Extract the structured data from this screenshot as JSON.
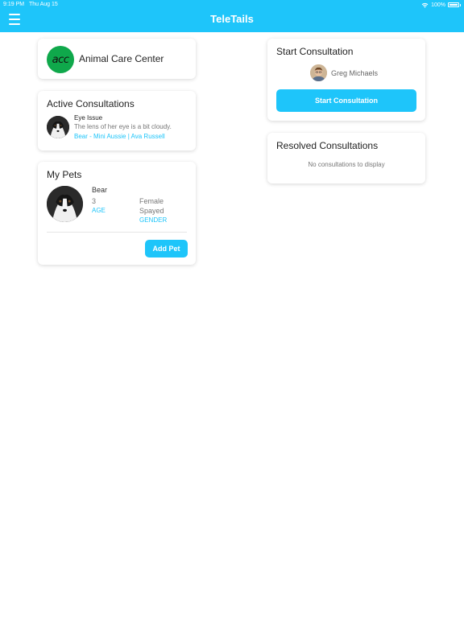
{
  "status_bar": {
    "time": "9:19 PM",
    "date": "Thu Aug 15",
    "battery": "100%",
    "wifi_icon": "wifi-icon",
    "battery_icon": "battery-icon"
  },
  "header": {
    "title": "TeleTails",
    "menu_icon": "hamburger-menu-icon"
  },
  "colors": {
    "accent": "#1ec5fa",
    "logo_green": "#0fa84b"
  },
  "clinic": {
    "logo_text": "acc",
    "name": "Animal Care Center"
  },
  "active_consultations": {
    "title": "Active Consultations",
    "items": [
      {
        "issue": "Eye Issue",
        "description": "The lens of her eye is a bit cloudy.",
        "meta": "Bear - Mini Aussie | Ava Russell"
      }
    ]
  },
  "my_pets": {
    "title": "My Pets",
    "pets": [
      {
        "name": "Bear",
        "age": "3",
        "age_label": "AGE",
        "gender": "Female",
        "spayed": "Spayed",
        "gender_label": "GENDER"
      }
    ],
    "add_button": "Add Pet"
  },
  "start_consultation": {
    "title": "Start Consultation",
    "vet_name": "Greg Michaels",
    "button": "Start Consultation"
  },
  "resolved_consultations": {
    "title": "Resolved Consultations",
    "empty_text": "No consultations to display"
  }
}
